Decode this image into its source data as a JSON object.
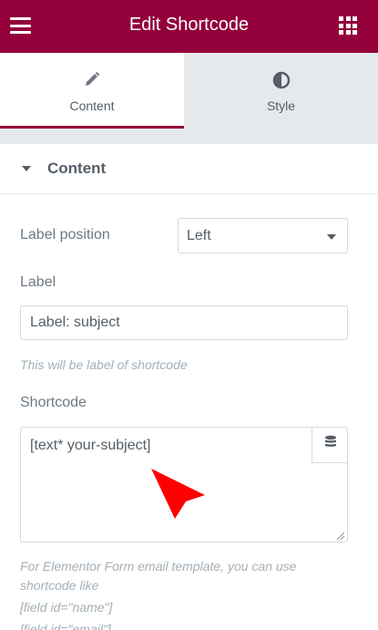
{
  "header": {
    "title": "Edit Shortcode",
    "menu_icon": "hamburger-menu-icon",
    "apps_icon": "grid-apps-icon",
    "background": "#93003c"
  },
  "tabs": [
    {
      "label": "Content",
      "icon": "pencil-icon",
      "active": true
    },
    {
      "label": "Style",
      "icon": "half-circle-contrast-icon",
      "active": false
    }
  ],
  "section": {
    "title": "Content",
    "expanded": true
  },
  "fields": {
    "label_position": {
      "label": "Label position",
      "value": "Left"
    },
    "label": {
      "label": "Label",
      "value": "Label: subject",
      "description": "This will be label of shortcode"
    },
    "shortcode": {
      "label": "Shortcode",
      "value": "[text* your-subject]",
      "dynamic_icon": "database-icon",
      "description_lines": [
        "For Elementor Form email template, you can use",
        "shortcode like",
        "[field id=\"name\"]",
        "[field id=\"email\"]"
      ]
    }
  },
  "colors": {
    "accent": "#93003c",
    "panel_gray": "#e6e9ec",
    "cursor": "#ff0000"
  }
}
